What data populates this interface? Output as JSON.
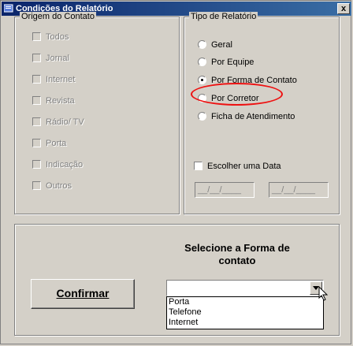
{
  "window": {
    "title": "Condições do Relatório",
    "close_label": "x"
  },
  "origem": {
    "legend": "Origem do Contato",
    "items": [
      {
        "label": "Todos"
      },
      {
        "label": "Jornal"
      },
      {
        "label": "Internet"
      },
      {
        "label": "Revista"
      },
      {
        "label": "Rádio/ TV"
      },
      {
        "label": "Porta"
      },
      {
        "label": "Indicação"
      },
      {
        "label": "Outros"
      }
    ]
  },
  "tipo": {
    "legend": "Tipo de Relatório",
    "options": [
      {
        "label": "Geral",
        "selected": false
      },
      {
        "label": "Por Equipe",
        "selected": false
      },
      {
        "label": "Por Forma de Contato",
        "selected": true
      },
      {
        "label": "Por Corretor",
        "selected": false
      },
      {
        "label": "Ficha de Atendimento",
        "selected": false
      }
    ],
    "date_check_label": "Escolher uma Data",
    "date_from": "__/__/____",
    "date_to": "__/__/____"
  },
  "bottom": {
    "confirm_label": "Confirmar",
    "select_label": "Selecione a Forma de contato",
    "combo_value": "",
    "dropdown_options": [
      "Porta",
      "Telefone",
      "Internet"
    ]
  },
  "colors": {
    "title_bar": "#0a246a",
    "highlight": "#e11111"
  }
}
